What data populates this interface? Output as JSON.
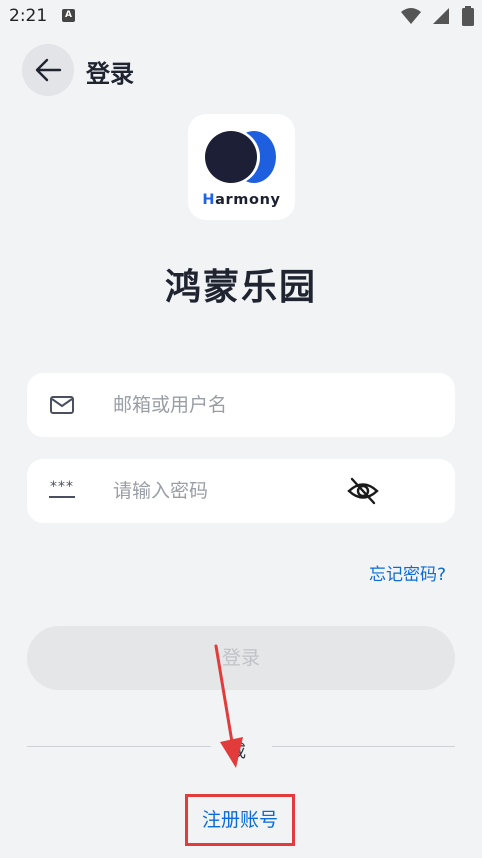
{
  "status_bar": {
    "time": "2:21",
    "notification_icon": "A"
  },
  "header": {
    "back_icon": "arrow-left-icon",
    "title": "登录"
  },
  "logo": {
    "brand_first_letter": "H",
    "brand_rest": "armony",
    "accent_color": "#1e63e6"
  },
  "app_name": "鸿蒙乐园",
  "form": {
    "username_placeholder": "邮箱或用户名",
    "password_placeholder": "请输入密码",
    "password_mask_icon": "***",
    "forgot_password": "忘记密码?",
    "login_button": "登录",
    "divider_text": "或",
    "register_button": "注册账号"
  },
  "colors": {
    "background": "#f1f3f5",
    "link": "#0b6bd8",
    "highlight": "#e23b3b"
  }
}
